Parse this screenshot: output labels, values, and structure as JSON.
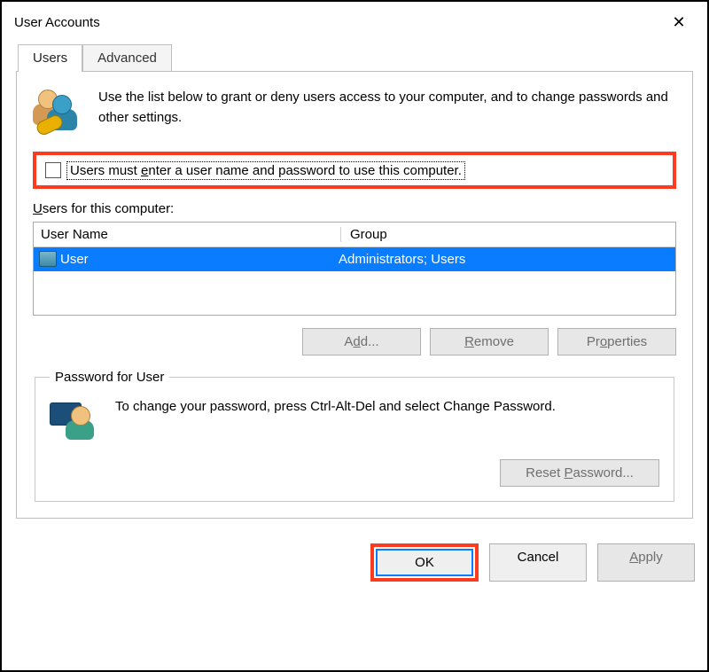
{
  "window": {
    "title": "User Accounts",
    "close": "✕"
  },
  "tabs": {
    "users": "Users",
    "advanced": "Advanced"
  },
  "intro": {
    "text": "Use the list below to grant or deny users access to your computer, and to change passwords and other settings."
  },
  "checkbox": {
    "label_prefix": "Users must ",
    "label_under": "e",
    "label_rest": "nter a user name and password to use this computer.",
    "checked": false
  },
  "users_label": {
    "under": "U",
    "rest": "sers for this computer:"
  },
  "list": {
    "col_name": "User Name",
    "col_group": "Group",
    "rows": [
      {
        "name": "User",
        "group": "Administrators; Users",
        "selected": true
      }
    ]
  },
  "buttons": {
    "add_pre": "A",
    "add_u": "d",
    "add_post": "d...",
    "remove_u": "R",
    "remove_rest": "emove",
    "properties_pre": "Pr",
    "properties_u": "o",
    "properties_post": "perties"
  },
  "pw_group": {
    "legend": "Password for User",
    "text": "To change your password, press Ctrl-Alt-Del and select Change Password.",
    "reset_pre": "Reset ",
    "reset_u": "P",
    "reset_post": "assword..."
  },
  "bottom": {
    "ok": "OK",
    "cancel": "Cancel",
    "apply_u": "A",
    "apply_rest": "pply"
  }
}
